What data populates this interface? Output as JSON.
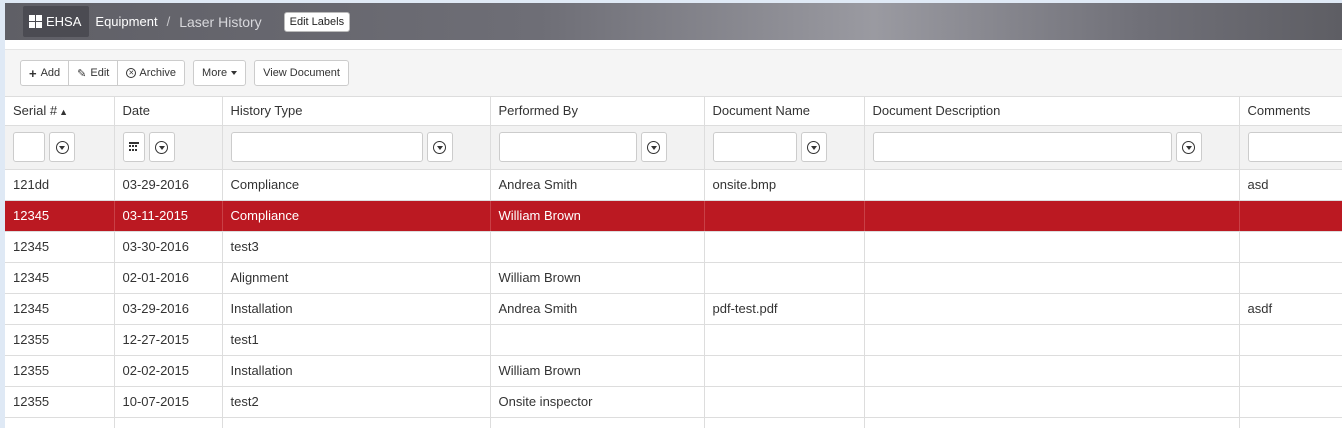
{
  "header": {
    "brand": "EHSA",
    "crumb_parent": "Equipment",
    "crumb_separator": "/",
    "crumb_current": "Laser History",
    "edit_labels": "Edit Labels"
  },
  "toolbar": {
    "add": "Add",
    "edit": "Edit",
    "archive": "Archive",
    "more": "More",
    "view_document": "View Document"
  },
  "table": {
    "columns": [
      "Serial #",
      "Date",
      "History Type",
      "Performed By",
      "Document Name",
      "Document Description",
      "Comments"
    ],
    "sort_indicator": "▲",
    "rows": [
      [
        "121dd",
        "03-29-2016",
        "Compliance",
        "Andrea Smith",
        "onsite.bmp",
        "",
        "asd"
      ],
      [
        "12345",
        "03-11-2015",
        "Compliance",
        "William Brown",
        "",
        "",
        ""
      ],
      [
        "12345",
        "03-30-2016",
        "test3",
        "",
        "",
        "",
        ""
      ],
      [
        "12345",
        "02-01-2016",
        "Alignment",
        "William Brown",
        "",
        "",
        ""
      ],
      [
        "12345",
        "03-29-2016",
        "Installation",
        "Andrea Smith",
        "pdf-test.pdf",
        "",
        "asdf"
      ],
      [
        "12355",
        "12-27-2015",
        "test1",
        "",
        "",
        "",
        ""
      ],
      [
        "12355",
        "02-02-2015",
        "Installation",
        "William Brown",
        "",
        "",
        ""
      ],
      [
        "12355",
        "10-07-2015",
        "test2",
        "Onsite inspector",
        "",
        "",
        ""
      ],
      [
        "",
        "",
        "",
        "",
        "",
        "",
        ""
      ]
    ],
    "selected_row": 1
  },
  "colors": {
    "selected_row": "#bb1922",
    "header_bar": "#6e6e76"
  }
}
